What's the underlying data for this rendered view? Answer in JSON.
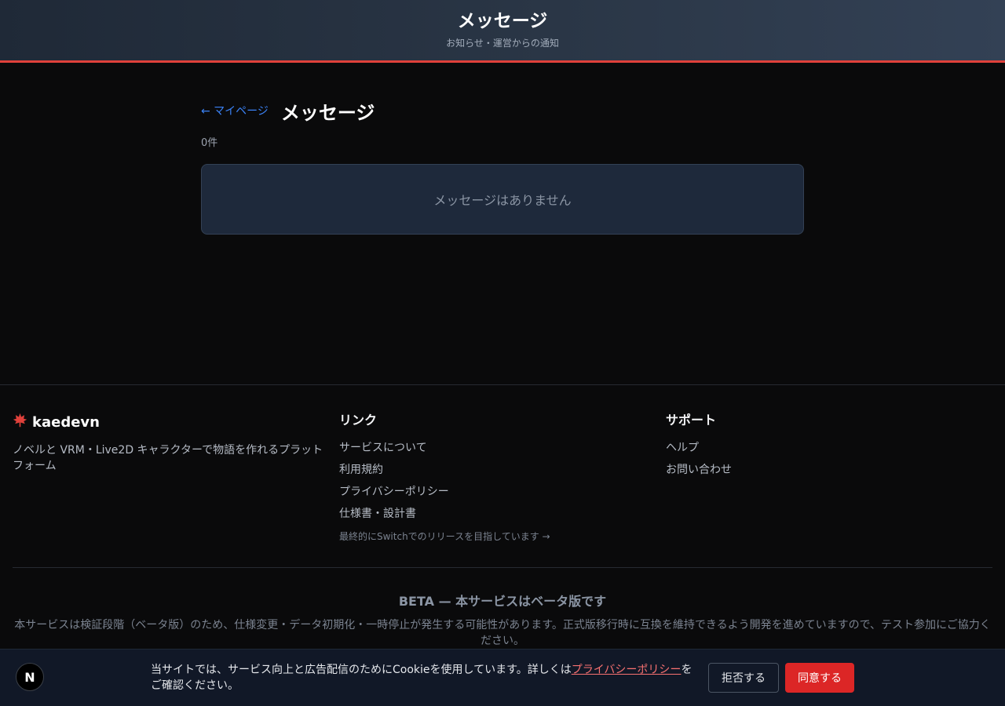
{
  "header": {
    "title": "メッセージ",
    "subtitle": "お知らせ・運営からの通知"
  },
  "main": {
    "back_label": "← マイページ",
    "page_title": "メッセージ",
    "count": "0件",
    "empty_text": "メッセージはありません"
  },
  "footer": {
    "brand_icon": "maple-leaf-icon",
    "brand_name": "kaedevn",
    "brand_desc": "ノベルと VRM・Live2D キャラクターで物語を作れるプラットフォーム",
    "links_title": "リンク",
    "links": [
      "サービスについて",
      "利用規約",
      "プライバシーポリシー",
      "仕様書・設計書"
    ],
    "switch_note": "最終的にSwitchでのリリースを目指しています →",
    "support_title": "サポート",
    "support_links": [
      "ヘルプ",
      "お問い合わせ"
    ],
    "beta_title": "BETA — 本サービスはベータ版です",
    "beta_desc": "本サービスは検証段階（ベータ版）のため、仕様変更・データ初期化・一時停止が発生する可能性があります。正式版移行時に互換を維持できるよう開発を進めていますので、テスト参加にご協力ください。"
  },
  "cookie": {
    "badge": "N",
    "text_before": "当サイトでは、サービス向上と広告配信のためにCookieを使用しています。詳しくは",
    "policy_link": "プライバシーポリシー",
    "text_after": "をご確認ください。",
    "reject_label": "拒否する",
    "accept_label": "同意する"
  },
  "colors": {
    "accent": "#e0413b",
    "link": "#3b82f6",
    "accept_button": "#dc2626"
  }
}
